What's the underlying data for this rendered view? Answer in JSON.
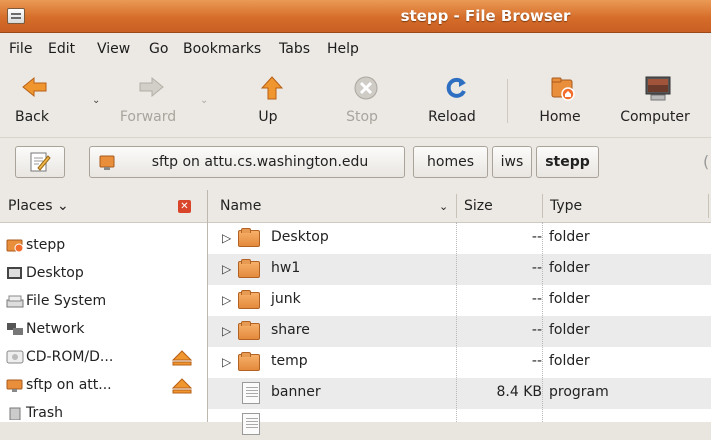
{
  "window": {
    "title": "stepp - File Browser"
  },
  "menu": [
    "File",
    "Edit",
    "View",
    "Go",
    "Bookmarks",
    "Tabs",
    "Help"
  ],
  "toolbar": {
    "back": "Back",
    "forward": "Forward",
    "up": "Up",
    "stop": "Stop",
    "reload": "Reload",
    "home": "Home",
    "computer": "Computer"
  },
  "location": {
    "root": "sftp on attu.cs.washington.edu",
    "crumbs": [
      "homes",
      "iws",
      "stepp"
    ]
  },
  "sidebar": {
    "header": "Places",
    "items": [
      {
        "label": "stepp",
        "icon": "home-folder-icon"
      },
      {
        "label": "Desktop",
        "icon": "desktop-icon"
      },
      {
        "label": "File System",
        "icon": "drive-icon"
      },
      {
        "label": "Network",
        "icon": "network-icon"
      },
      {
        "label": "CD-ROM/D...",
        "icon": "cdrom-icon"
      },
      {
        "label": "sftp on att...",
        "icon": "network-folder-icon"
      },
      {
        "label": "Trash",
        "icon": "trash-icon"
      }
    ]
  },
  "columns": {
    "name": "Name",
    "size": "Size",
    "type": "Type"
  },
  "files": [
    {
      "name": "Desktop",
      "size": "--",
      "type": "folder"
    },
    {
      "name": "hw1",
      "size": "--",
      "type": "folder"
    },
    {
      "name": "junk",
      "size": "--",
      "type": "folder"
    },
    {
      "name": "share",
      "size": "--",
      "type": "folder"
    },
    {
      "name": "temp",
      "size": "--",
      "type": "folder"
    },
    {
      "name": "banner",
      "size": "8.4 KB",
      "type": "program"
    }
  ],
  "colors": {
    "titlebar": "#d66d2a",
    "accent": "#e38a3c"
  }
}
